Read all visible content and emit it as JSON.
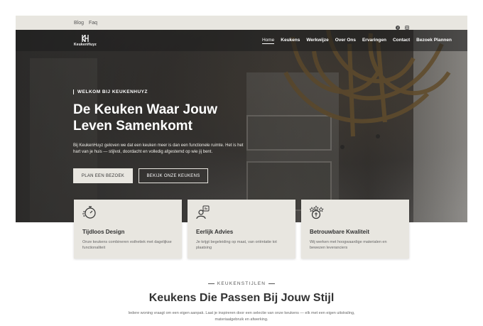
{
  "topbar": {
    "links": [
      "Blog",
      "Faq"
    ],
    "social_icons": [
      "facebook-icon",
      "instagram-icon"
    ]
  },
  "nav": {
    "logo_text": "KeukenHuyz",
    "items": [
      "Home",
      "Keukens",
      "Werkwijze",
      "Over Ons",
      "Ervaringen",
      "Contact",
      "Bezoek Plannen"
    ],
    "active_index": 0
  },
  "hero": {
    "eyebrow": "WELKOM BIJ KEUKENHUYZ",
    "headline": "De Keuken Waar Jouw Leven Samenkomt",
    "intro": "Bij KeukenHuyz geloven we dat een keuken meer is dan een functionele ruimte. Het is het hart van je huis — stijlvol, doordacht en volledig afgestemd op wie jij bent.",
    "primary_button": "PLAN EEN BEZOEK",
    "secondary_button": "BEKIJK ONZE KEUKENS"
  },
  "features": [
    {
      "icon": "stopwatch-icon",
      "title": "Tijdloos Design",
      "text": "Onze keukens combineren esthetiek met dagelijkse functionaliteit"
    },
    {
      "icon": "advisor-icon",
      "title": "Eerlijk Advies",
      "text": "Je krijgt begeleiding op maat, van oriëntatie tot plaatsing"
    },
    {
      "icon": "quality-medal-icon",
      "title": "Betrouwbare Kwaliteit",
      "text": "Wij werken met hoogwaardige materialen en bewezen leveranciers"
    }
  ],
  "styles_section": {
    "kicker": "KEUKENSTIJLEN",
    "title": "Keukens Die Passen Bij Jouw Stijl",
    "text": "Iedere woning vraagt om een eigen aanpak. Laat je inspireren door een selectie van onze keukens — elk met een eigen uitstraling, materiaalgebruik en afwerking."
  },
  "colors": {
    "accent_bg": "#e8e6e0",
    "text_dark": "#333333"
  }
}
